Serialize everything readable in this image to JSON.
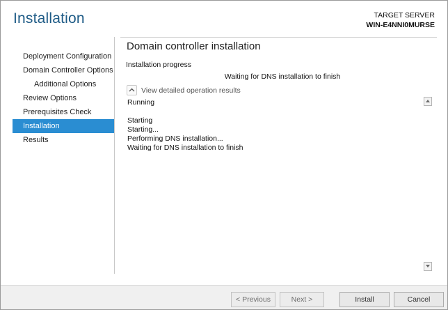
{
  "window": {
    "title": "Installation",
    "target_server_label": "TARGET SERVER",
    "target_server_name": "WIN-E4NNI0MURSE"
  },
  "sidebar": {
    "items": [
      {
        "label": "Deployment Configuration",
        "active": false
      },
      {
        "label": "Domain Controller Options",
        "active": false
      },
      {
        "label": "Additional Options",
        "active": false,
        "sub": true
      },
      {
        "label": "Review Options",
        "active": false
      },
      {
        "label": "Prerequisites Check",
        "active": false
      },
      {
        "label": "Installation",
        "active": true
      },
      {
        "label": "Results",
        "active": false
      }
    ]
  },
  "main": {
    "section_title": "Domain controller installation",
    "progress_label": "Installation progress",
    "status_message": "Waiting for DNS installation to finish",
    "expander_label": "View detailed operation results",
    "log_lines": [
      "Running",
      "",
      "Starting",
      "Starting...",
      "Performing DNS installation...",
      "Waiting for DNS installation to finish"
    ]
  },
  "footer": {
    "previous_label": "< Previous",
    "next_label": "Next >",
    "install_label": "Install",
    "cancel_label": "Cancel"
  },
  "colors": {
    "title": "#1e5b86",
    "active_nav": "#2a8dd2"
  }
}
